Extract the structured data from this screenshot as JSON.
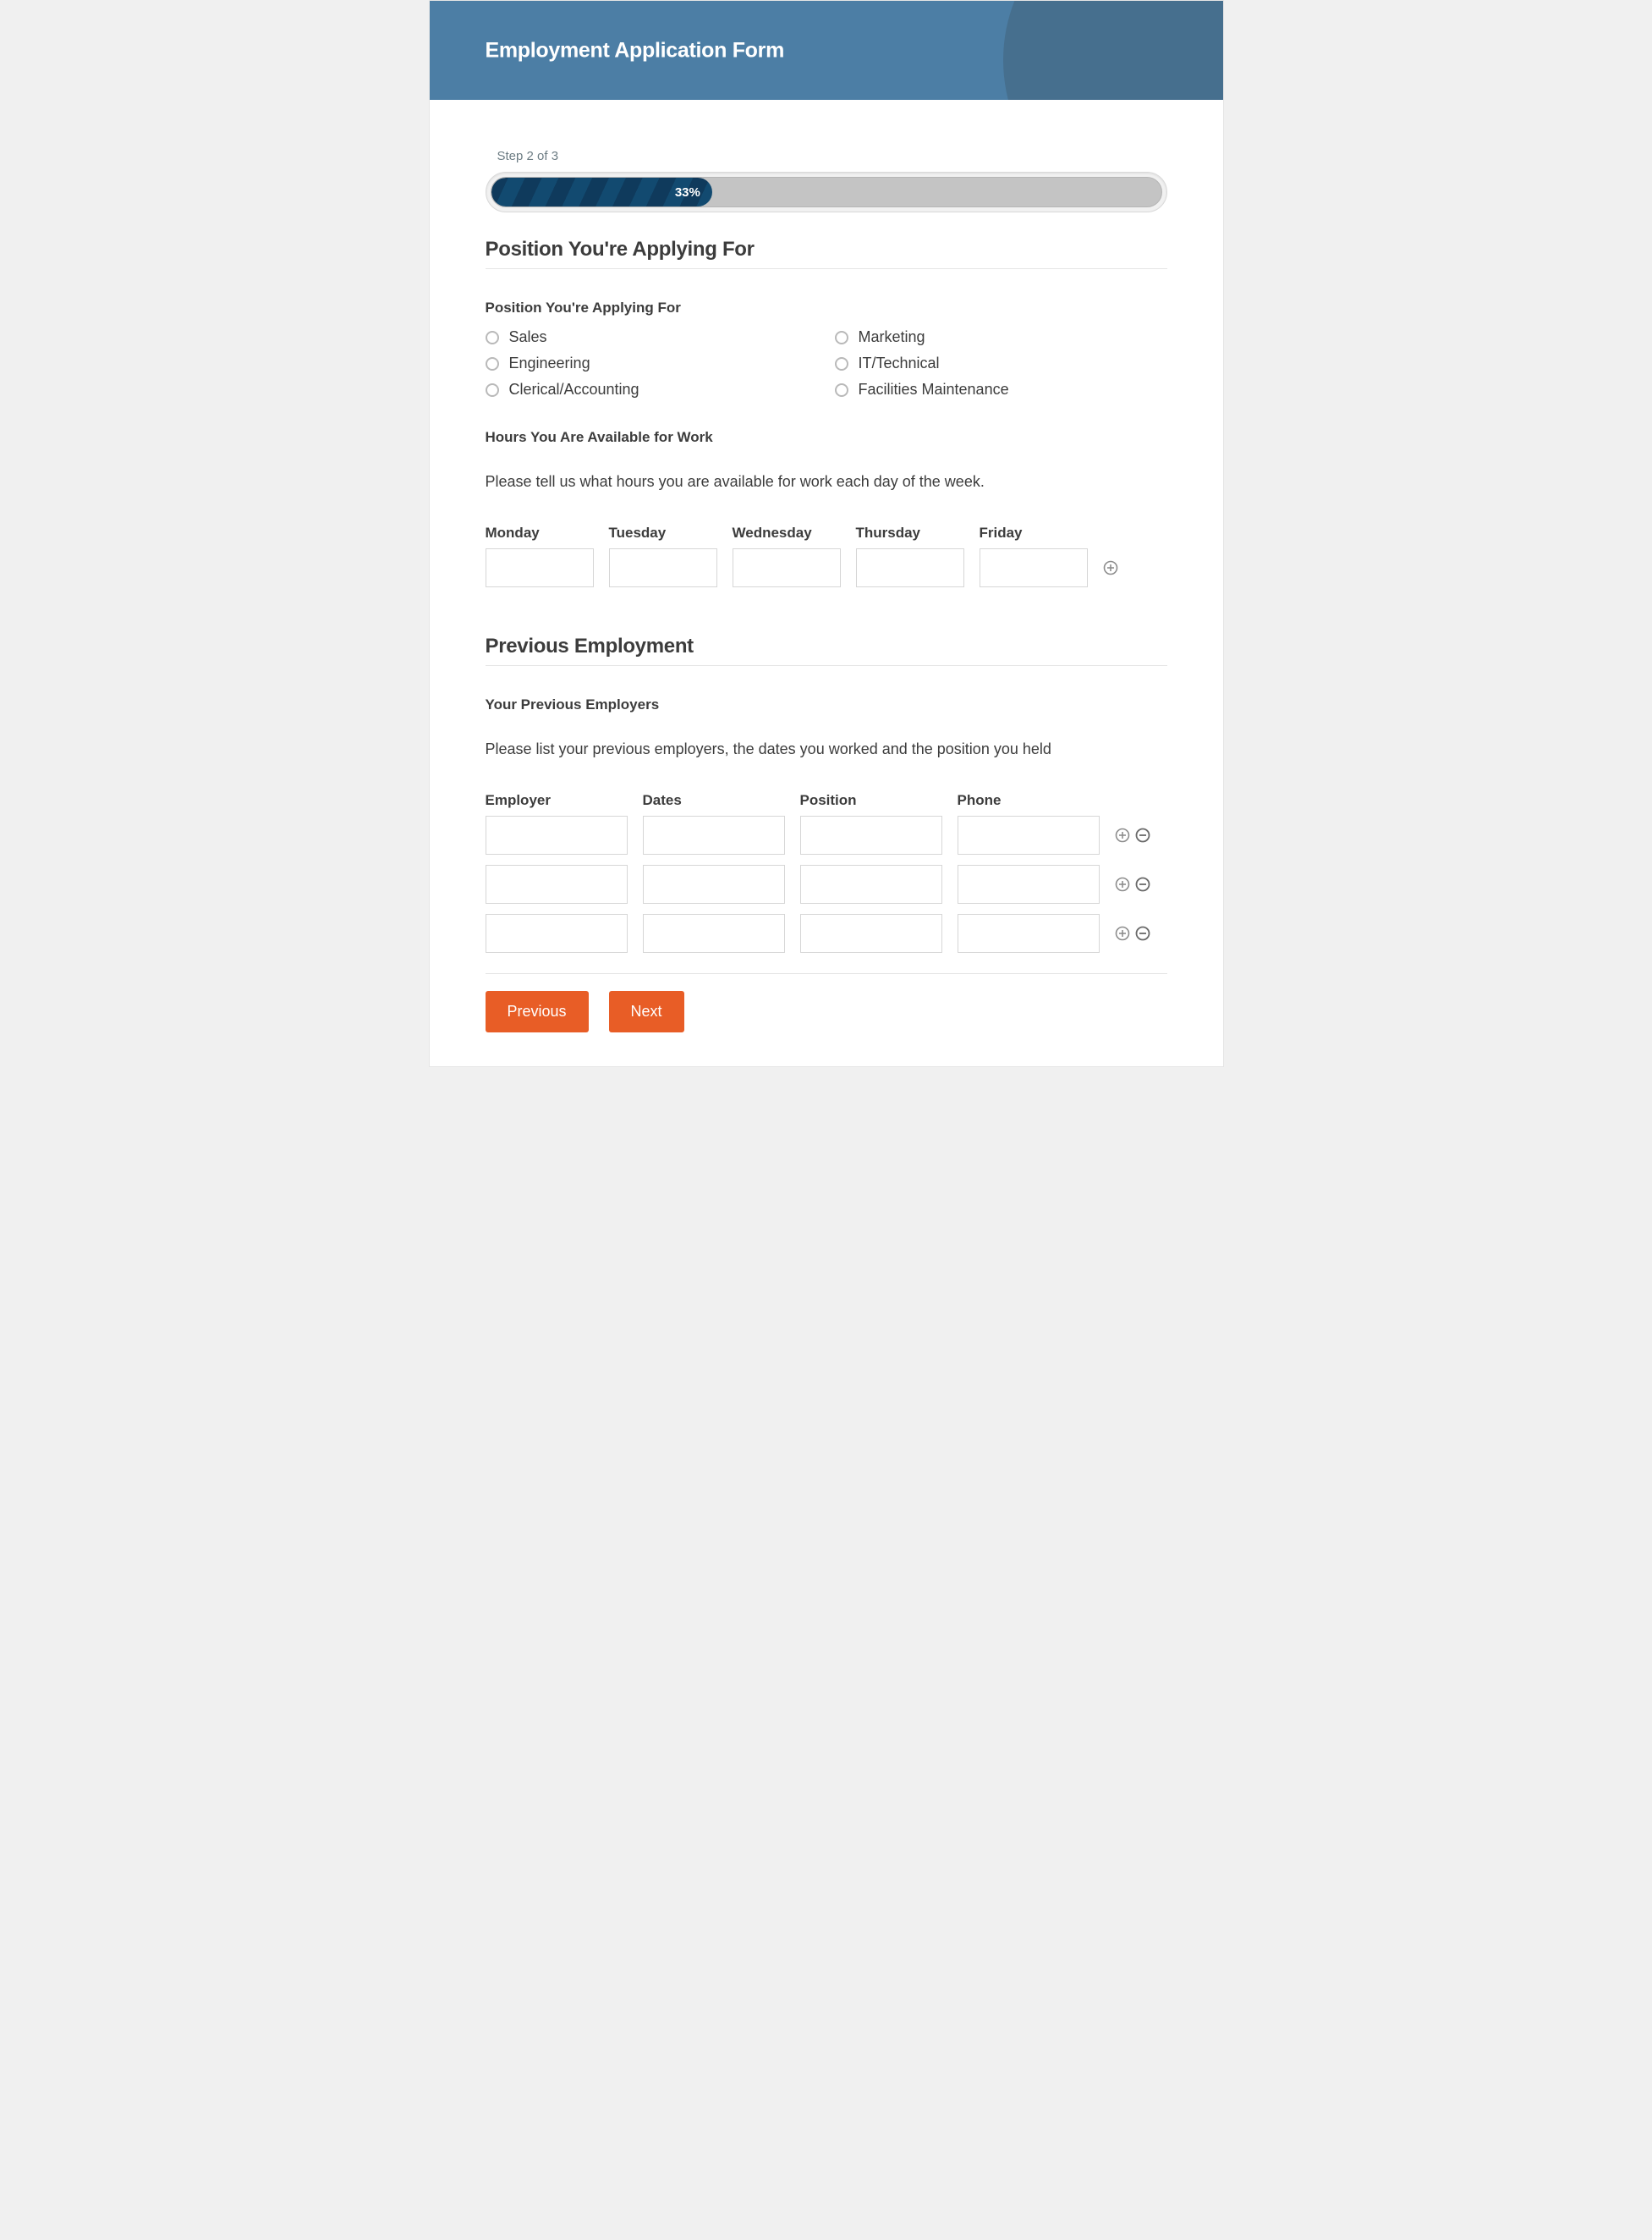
{
  "header": {
    "title": "Employment Application Form"
  },
  "progress": {
    "step_label": "Step 2 of 3",
    "percent_label": "33%",
    "percent": 33
  },
  "section_position": {
    "heading": "Position You're Applying For",
    "question_label": "Position You're Applying For",
    "options": [
      "Sales",
      "Marketing",
      "Engineering",
      "IT/Technical",
      "Clerical/Accounting",
      "Facilities Maintenance"
    ]
  },
  "section_hours": {
    "label": "Hours You Are Available for Work",
    "help": "Please tell us what hours you are available for work each day of the week.",
    "columns": [
      "Monday",
      "Tuesday",
      "Wednesday",
      "Thursday",
      "Friday"
    ],
    "values": [
      "",
      "",
      "",
      "",
      ""
    ]
  },
  "section_previous": {
    "heading": "Previous Employment",
    "label": "Your Previous Employers",
    "help": "Please list your previous employers, the dates you worked and the position you held",
    "columns": [
      "Employer",
      "Dates",
      "Position",
      "Phone"
    ],
    "rows": [
      {
        "employer": "",
        "dates": "",
        "position": "",
        "phone": ""
      },
      {
        "employer": "",
        "dates": "",
        "position": "",
        "phone": ""
      },
      {
        "employer": "",
        "dates": "",
        "position": "",
        "phone": ""
      }
    ]
  },
  "buttons": {
    "previous": "Previous",
    "next": "Next"
  }
}
